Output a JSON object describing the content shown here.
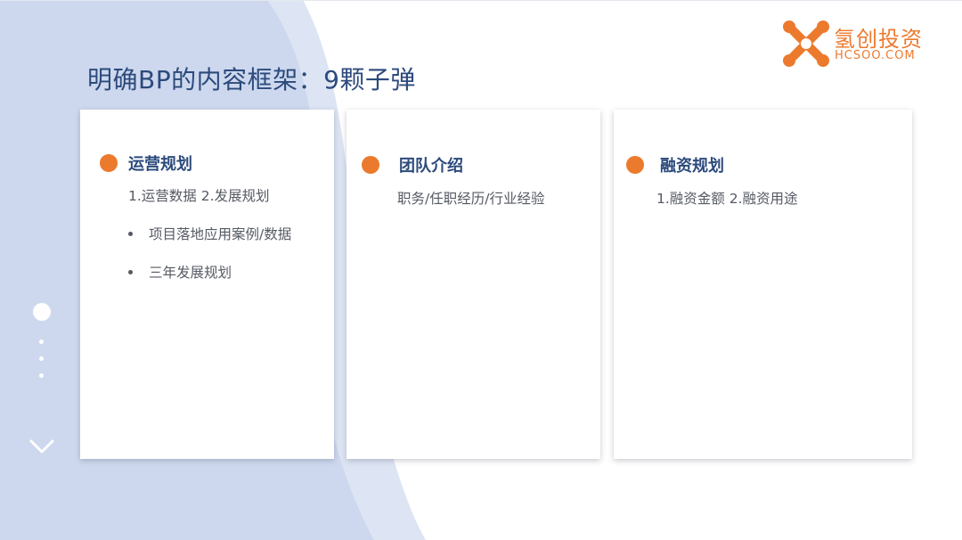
{
  "logo": {
    "name": "氢创投资",
    "domain": "HCSOO.COM",
    "icon": "x-logo-icon",
    "color": "#ec7a2d"
  },
  "title": "明确BP的内容框架：9颗子弹",
  "cards": [
    {
      "title": "运营规划",
      "subtitle": "1.运营数据 2.发展规划",
      "bullets": [
        "项目落地应用案例/数据",
        "三年发展规划"
      ]
    },
    {
      "title": "团队介绍",
      "subtitle": "职务/任职经历/行业经验",
      "bullets": []
    },
    {
      "title": "融资规划",
      "subtitle": "1.融资金额  2.融资用途",
      "bullets": []
    }
  ],
  "colors": {
    "accent": "#ec7a2d",
    "title": "#2c4a7c",
    "background_shape": "#cdd8ee",
    "background_shape_light": "#dde5f4"
  },
  "nav": {
    "icons": [
      "nav-dot-icon",
      "nav-dot-small-icon",
      "chevron-down-icon"
    ]
  }
}
